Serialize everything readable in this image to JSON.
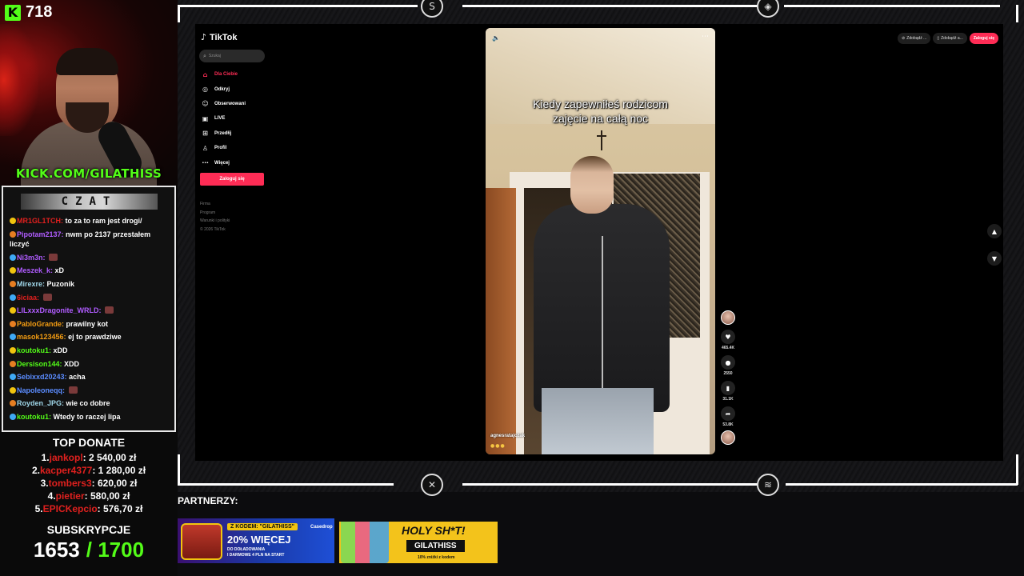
{
  "overlay": {
    "viewer_count": "718",
    "kick_url": "KICK.COM/GILATHISS",
    "chat_title": "CZAT",
    "chat": [
      {
        "user": "MR1GL1TCH:",
        "color": "#e0201e",
        "text": "to za to ram jest drogi/",
        "emote": false
      },
      {
        "user": "Pipotam2137:",
        "color": "#b05cff",
        "text": "nwm po 2137 przestałem liczyć",
        "emote": false
      },
      {
        "user": "Ni3m3n:",
        "color": "#b05cff",
        "text": "",
        "emote": true
      },
      {
        "user": "Meszek_k:",
        "color": "#b05cff",
        "text": "xD",
        "emote": false
      },
      {
        "user": "Mirexre:",
        "color": "#9fd6e8",
        "text": "Puzonik",
        "emote": false
      },
      {
        "user": "6iciaa:",
        "color": "#e0201e",
        "text": "",
        "emote": true
      },
      {
        "user": "LILxxxDragonite_WRLD:",
        "color": "#b05cff",
        "text": "",
        "emote": true
      },
      {
        "user": "PabloGrande:",
        "color": "#f39c12",
        "text": "prawilny kot",
        "emote": false
      },
      {
        "user": "masok123456:",
        "color": "#f39c12",
        "text": "ej to prawdziwe",
        "emote": false
      },
      {
        "user": "koutoku1:",
        "color": "#53fc18",
        "text": "xDD",
        "emote": false
      },
      {
        "user": "Dersison144:",
        "color": "#53fc18",
        "text": "XDD",
        "emote": false
      },
      {
        "user": "Sebixxd20243:",
        "color": "#5b8cff",
        "text": "acha",
        "emote": false
      },
      {
        "user": "Napoleoneqq:",
        "color": "#5b8cff",
        "text": "",
        "emote": true
      },
      {
        "user": "Royden_JPG:",
        "color": "#9fd6e8",
        "text": "wie co dobre",
        "emote": false
      },
      {
        "user": "koutoku1:",
        "color": "#53fc18",
        "text": "Wtedy to raczej lipa",
        "emote": false
      }
    ],
    "top_donate_title": "TOP DONATE",
    "donors": [
      {
        "rank": "1.",
        "name": "jankopl",
        "amount": ": 2 540,00 zł"
      },
      {
        "rank": "2.",
        "name": "kacper4377",
        "amount": ": 1 280,00 zł"
      },
      {
        "rank": "3.",
        "name": "tombers3",
        "amount": ": 620,00 zł"
      },
      {
        "rank": "4.",
        "name": "pietier",
        "amount": ": 580,00 zł"
      },
      {
        "rank": "5.",
        "name": "EPICKepcio",
        "amount": ": 576,70 zł"
      }
    ],
    "subs_title": "SUBSKRYPCJE",
    "subs_current": "1653",
    "subs_goal": "/ 1700",
    "partners_label": "PARTNERZY:",
    "casedrop": {
      "code": "Z KODEM: \"GILATHISS\"",
      "brand": "Casedrop",
      "big": "20% WIĘCEJ",
      "small1": "DO DOŁADOWANIA",
      "small2": "I DARMOWE 4 PLN NA START"
    },
    "holy": {
      "headline": "HOLY SH*T!",
      "code": "GILATHISS",
      "small": "10% zniżki z kodem"
    }
  },
  "tiktok": {
    "logo": "TikTok",
    "search_placeholder": "Szukaj",
    "nav": [
      {
        "icon": "⌂",
        "label": "Dla Ciebie",
        "active": true
      },
      {
        "icon": "◎",
        "label": "Odkryj",
        "active": false
      },
      {
        "icon": "☺",
        "label": "Obserwowani",
        "active": false
      },
      {
        "icon": "▣",
        "label": "LIVE",
        "active": false
      },
      {
        "icon": "⊞",
        "label": "Przedłij",
        "active": false
      },
      {
        "icon": "♙",
        "label": "Profil",
        "active": false
      },
      {
        "icon": "⋯",
        "label": "Więcej",
        "active": false
      }
    ],
    "login_side": "Zaloguj się",
    "footer": [
      "Firma",
      "Program",
      "Warunki i polityki",
      "© 2026 TikTok"
    ],
    "top_right": [
      "Zdobądź ...",
      "Zdobądź a...",
      "Zaloguj się"
    ],
    "video": {
      "caption_line1": "Kiedy zapewniłeś rodzicom",
      "caption_line2": "zajęcie na całą noc",
      "author": "agnesratajczak",
      "emojis": "●●●"
    },
    "actions": {
      "likes": "465.4K",
      "comments": "2550",
      "saves": "31.1K",
      "shares": "53.8K"
    }
  }
}
